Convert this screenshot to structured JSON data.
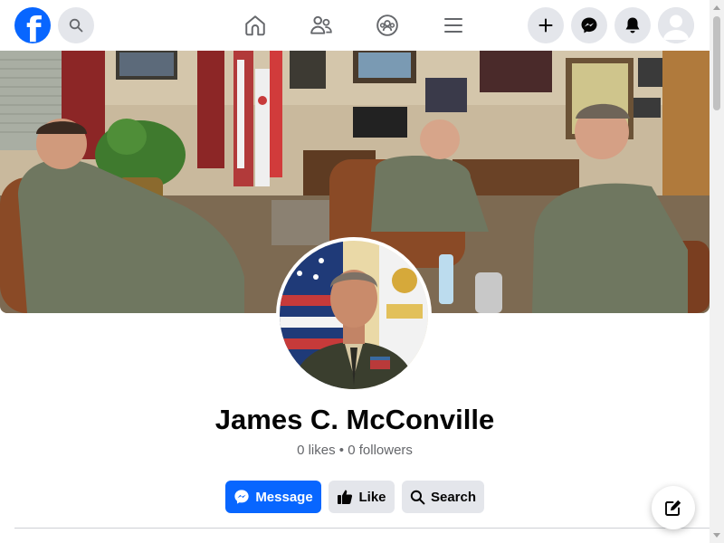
{
  "header": {
    "logo_letter": "f",
    "nav_icons": [
      "home-icon",
      "friends-icon",
      "groups-icon",
      "menu-icon"
    ],
    "right_icons": [
      "plus-icon",
      "messenger-icon",
      "bell-icon",
      "account-icon"
    ]
  },
  "profile": {
    "name": "James C. McConville",
    "likes": "0 likes",
    "separator": "•",
    "followers": "0 followers"
  },
  "actions": {
    "message_label": "Message",
    "like_label": "Like",
    "search_label": "Search"
  },
  "colors": {
    "brand": "#0866ff",
    "button_gray": "#e4e6eb",
    "text_primary": "#050505",
    "text_secondary": "#65676b"
  }
}
